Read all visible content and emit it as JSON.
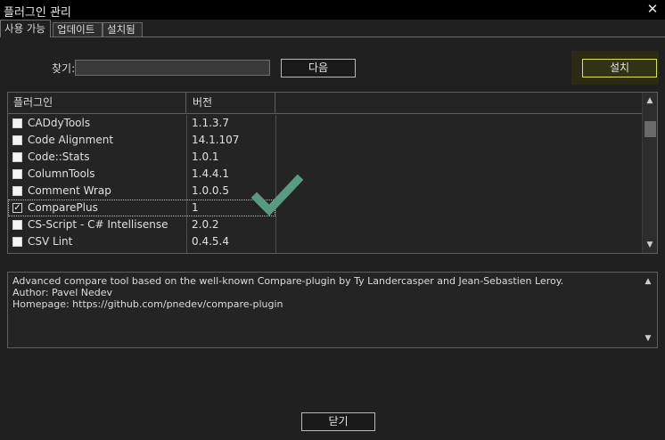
{
  "window": {
    "title": "플러그인 관리",
    "close_glyph": "✕"
  },
  "tabs": [
    {
      "label": "사용 가능",
      "active": true
    },
    {
      "label": "업데이트",
      "active": false
    },
    {
      "label": "설치됨",
      "active": false
    }
  ],
  "search": {
    "label": "찾기:",
    "value": ""
  },
  "buttons": {
    "next": "다음",
    "install": "설치",
    "close": "닫기"
  },
  "plugin_list": {
    "columns": [
      "플러그인",
      "버전"
    ],
    "rows": [
      {
        "name": "CADdyTools",
        "version": "1.1.3.7",
        "checked": false
      },
      {
        "name": "Code Alignment",
        "version": "14.1.107",
        "checked": false
      },
      {
        "name": "Code::Stats",
        "version": "1.0.1",
        "checked": false
      },
      {
        "name": "ColumnTools",
        "version": "1.4.4.1",
        "checked": false
      },
      {
        "name": "Comment Wrap",
        "version": "1.0.0.5",
        "checked": false
      },
      {
        "name": "ComparePlus",
        "version": "1",
        "checked": true,
        "selected": true
      },
      {
        "name": "CS-Script - C# Intellisense",
        "version": "2.0.2",
        "checked": false
      },
      {
        "name": "CSV Lint",
        "version": "0.4.5.4",
        "checked": false
      }
    ]
  },
  "description": {
    "line1": "Advanced compare tool based on the well-known Compare-plugin by Ty Landercasper and Jean-Sebastien Leroy.",
    "line2": "Author: Pavel Nedev",
    "line3": "Homepage: https://github.com/pnedev/compare-plugin"
  },
  "colors": {
    "accent_check": "#5a9a80",
    "install_border": "#e0e060",
    "background": "#202020"
  },
  "icons": {
    "close": "close-icon",
    "checkmark": "checkmark-icon",
    "scroll_up": "chevron-up-icon",
    "scroll_down": "chevron-down-icon"
  }
}
